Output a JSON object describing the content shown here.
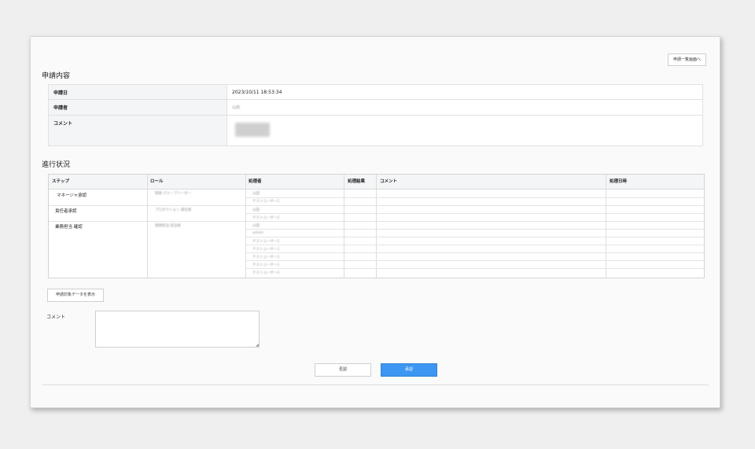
{
  "header": {
    "list_button": "申請一覧画面へ"
  },
  "application": {
    "title": "申請内容",
    "rows": [
      {
        "label": "申請日",
        "value": "2023/10/11 18:53:34"
      },
      {
        "label": "申請者",
        "value": "山田"
      },
      {
        "label": "コメント",
        "value": ""
      }
    ]
  },
  "progress": {
    "title": "進行状況",
    "columns": [
      "ステップ",
      "ロール",
      "処理者",
      "処理結果",
      "コメント",
      "処理日時"
    ],
    "steps": [
      {
        "step": "マネージャ承認",
        "role": "開発 グループリーダー",
        "handlers": [
          "山田",
          "テストユーザー2"
        ]
      },
      {
        "step": "責任者承認",
        "role": "プロダクション 責任者",
        "handlers": [
          "山田",
          "テストユーザー2"
        ]
      },
      {
        "step": "業務担当 確認",
        "role": "業務担当 担当者",
        "handlers": [
          "山田",
          "admin",
          "テストユーザー2",
          "テストユーザー2",
          "テストユーザー2",
          "テストユーザー2",
          "テストユーザー2"
        ]
      }
    ]
  },
  "actions": {
    "show_data_button": "申請対象データを表示",
    "comment_label": "コメント",
    "comment_value": "",
    "reject_button": "否認",
    "approve_button": "承認"
  }
}
